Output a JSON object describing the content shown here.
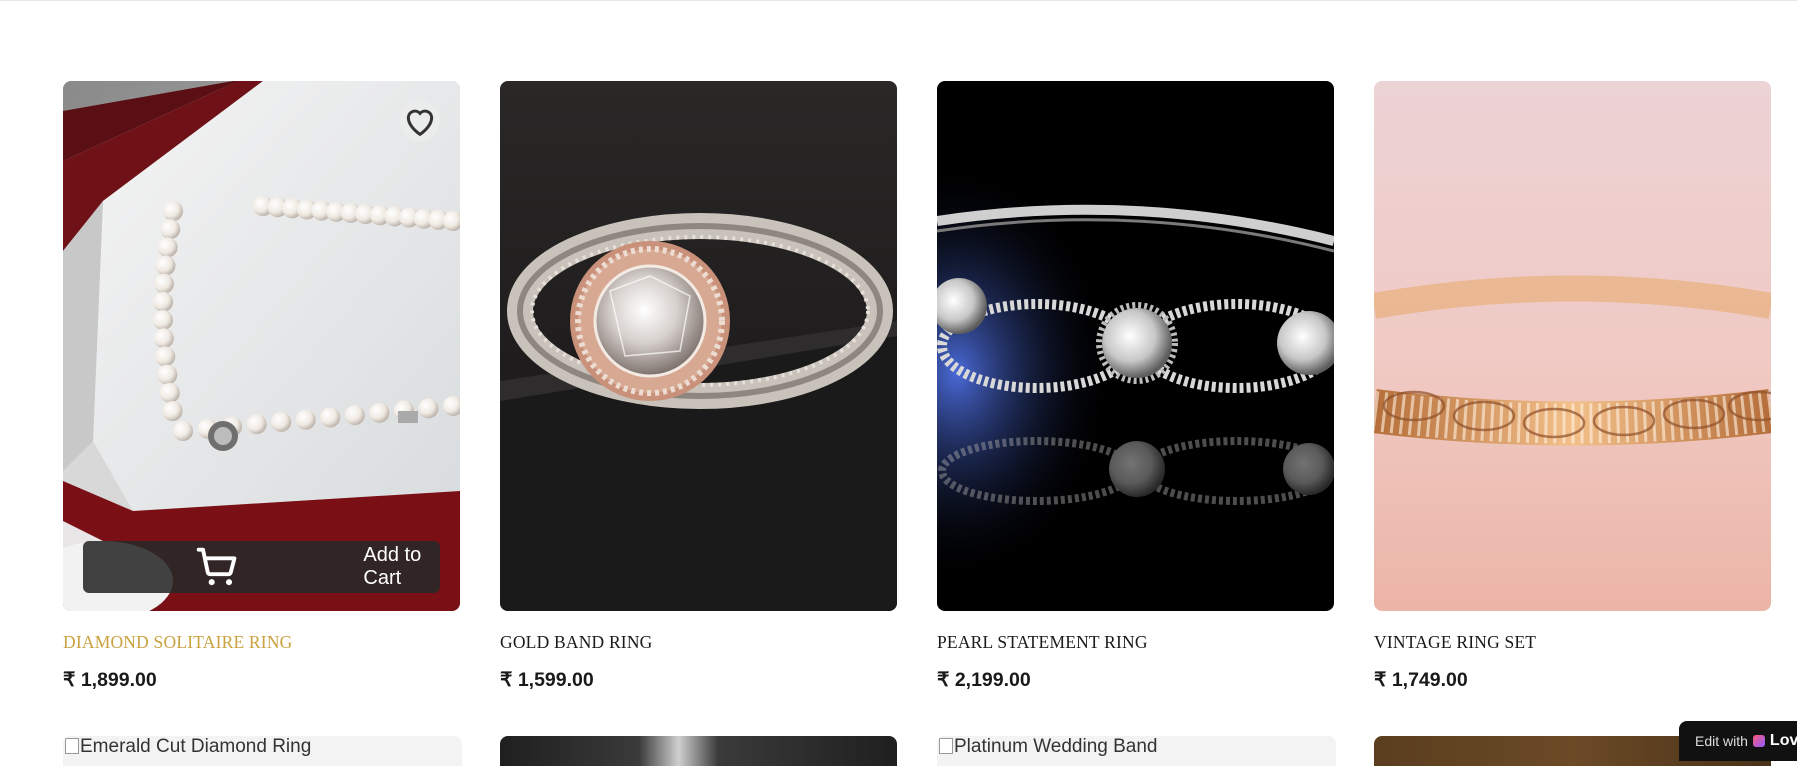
{
  "products": [
    {
      "name": "DIAMOND SOLITAIRE RING",
      "price": "₹ 1,899.00",
      "image": "pearl-necklace",
      "hovered": true
    },
    {
      "name": "GOLD BAND RING",
      "price": "₹ 1,599.00",
      "image": "halo-ring",
      "hovered": false
    },
    {
      "name": "PEARL STATEMENT RING",
      "price": "₹ 2,199.00",
      "image": "crystal-bracelet",
      "hovered": false
    },
    {
      "name": "VINTAGE RING SET",
      "price": "₹ 1,749.00",
      "image": "rose-gold-bracelet",
      "hovered": false
    }
  ],
  "card_actions": {
    "add_to_cart": "Add to Cart",
    "wishlist_icon": "heart-icon",
    "cart_icon": "cart-icon"
  },
  "next_row": [
    {
      "alt": "Emerald Cut Diamond Ring",
      "broken": true
    },
    {
      "alt": "",
      "broken": false
    },
    {
      "alt": "Platinum Wedding Band",
      "broken": true
    },
    {
      "alt": "",
      "broken": false
    }
  ],
  "edit_badge": {
    "prefix": "Edit with",
    "brand": "Lov"
  },
  "colors": {
    "active_name": "#c9a23f",
    "text": "#1a1a1a",
    "overlay": "#282828"
  }
}
